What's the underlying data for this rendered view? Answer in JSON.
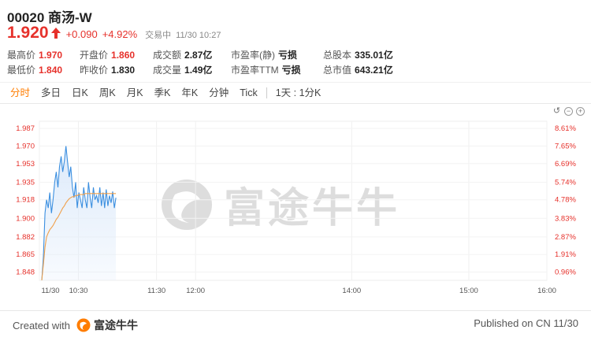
{
  "stock": {
    "code": "00020",
    "name": "商汤-W",
    "price": "1.920",
    "change": "+0.090",
    "change_pct": "+4.92%",
    "status": "交易中",
    "time": "11/30 10:27"
  },
  "stats": {
    "row1": [
      {
        "label": "最高价",
        "value": "1.970",
        "color": "red"
      },
      {
        "label": "开盘价",
        "value": "1.860",
        "color": "red"
      },
      {
        "label": "成交额",
        "value": "2.87亿",
        "color": "dark"
      },
      {
        "label": "市盈率(静)",
        "value": "亏损",
        "color": "dark"
      },
      {
        "label": "总股本",
        "value": "335.01亿",
        "color": "dark"
      }
    ],
    "row2": [
      {
        "label": "最低价",
        "value": "1.840",
        "color": "red"
      },
      {
        "label": "昨收价",
        "value": "1.830",
        "color": "dark"
      },
      {
        "label": "成交量",
        "value": "1.49亿",
        "color": "dark"
      },
      {
        "label": "市盈率TTM",
        "value": "亏损",
        "color": "dark"
      },
      {
        "label": "总市值",
        "value": "643.21亿",
        "color": "dark"
      }
    ]
  },
  "tabs": [
    "分时",
    "多日",
    "日K",
    "周K",
    "月K",
    "季K",
    "年K",
    "分钟",
    "Tick"
  ],
  "active_tab": "分时",
  "interval_label": "1天 : 1分K",
  "chart_data": {
    "type": "line",
    "y_left_ticks": [
      "1.987",
      "1.970",
      "1.953",
      "1.935",
      "1.918",
      "1.900",
      "1.882",
      "1.865",
      "1.848"
    ],
    "y_right_ticks": [
      "8.61%",
      "7.65%",
      "6.69%",
      "5.74%",
      "4.78%",
      "3.83%",
      "2.87%",
      "1.91%",
      "0.96%"
    ],
    "x_ticks": [
      "11/30",
      "10:30",
      "11:30",
      "12:00",
      "14:00",
      "15:00",
      "16:00"
    ],
    "series": [
      {
        "values": [
          1.84,
          1.862,
          1.905,
          1.918,
          1.91,
          1.925,
          1.905,
          1.918,
          1.935,
          1.945,
          1.93,
          1.95,
          1.96,
          1.945,
          1.955,
          1.97,
          1.955,
          1.94,
          1.95,
          1.93,
          1.92,
          1.935,
          1.91,
          1.925,
          1.918,
          1.91,
          1.93,
          1.918,
          1.91,
          1.935,
          1.92,
          1.91,
          1.93,
          1.918,
          1.922,
          1.915,
          1.93,
          1.912,
          1.925,
          1.91,
          1.928,
          1.912,
          1.922,
          1.915,
          1.926,
          1.91,
          1.92
        ]
      },
      {
        "values": [
          1.84,
          1.855,
          1.872,
          1.882,
          1.886,
          1.889,
          1.891,
          1.893,
          1.896,
          1.899,
          1.901,
          1.904,
          1.907,
          1.91,
          1.912,
          1.915,
          1.917,
          1.919,
          1.92,
          1.921,
          1.921,
          1.922,
          1.922,
          1.923,
          1.923,
          1.923,
          1.923,
          1.924,
          1.924,
          1.924,
          1.924,
          1.924,
          1.924,
          1.924,
          1.924,
          1.924,
          1.924,
          1.924,
          1.924,
          1.924,
          1.924,
          1.924,
          1.924,
          1.924,
          1.924,
          1.924,
          1.924
        ]
      }
    ],
    "colors": {
      "price": "#3b8fe0",
      "avg": "#f0a04b",
      "fill": "#dbe9fa",
      "up": "#e6312b"
    }
  },
  "watermark_text": "富途牛牛",
  "footer": {
    "created_label": "Created with",
    "brand": "富途牛牛",
    "published": "Published on CN 11/30"
  }
}
